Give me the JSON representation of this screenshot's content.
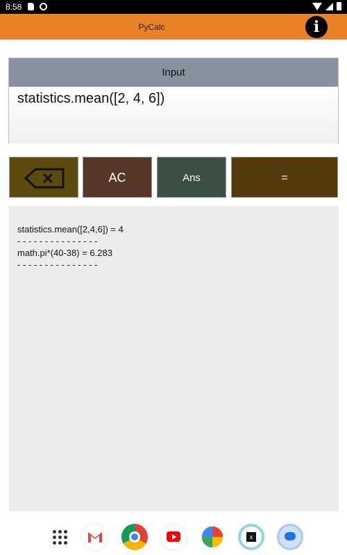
{
  "status_bar": {
    "time": "8:58"
  },
  "app_bar": {
    "title": "PyCalc",
    "info_icon_glyph": "i"
  },
  "input": {
    "header": "Input",
    "value": "statistics.mean([2, 4, 6])"
  },
  "buttons": {
    "backspace_icon": "backspace-icon",
    "ac": "AC",
    "ans": "Ans",
    "equals": "="
  },
  "output": {
    "lines": [
      "statistics.mean([2,4,6]) = 4",
      "- - - - - - - - - - - - - - -",
      "math.pi*(40-38) = 6.283",
      "- - - - - - - - - - - - - - -"
    ]
  },
  "dock": {
    "apps": [
      "apps-grid",
      "gmail",
      "chrome",
      "youtube",
      "photos",
      "pycalc",
      "messages"
    ]
  },
  "colors": {
    "app_bar": "#e98225",
    "backspace": "#5b4b0c",
    "ac": "#573529",
    "ans": "#3b5042",
    "equals": "#56390c",
    "input_header": "#86939e",
    "output_bg": "#ebeced"
  }
}
